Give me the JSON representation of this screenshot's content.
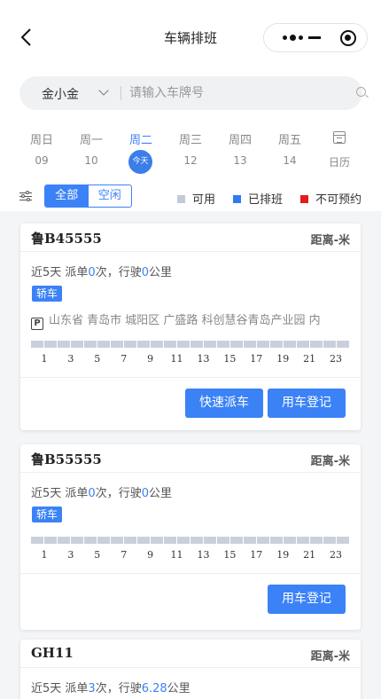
{
  "header": {
    "title": "车辆排班"
  },
  "search": {
    "owner": "金小金",
    "placeholder": "请输入车牌号"
  },
  "week": [
    {
      "weekday": "周日",
      "date": "09",
      "active": false
    },
    {
      "weekday": "周一",
      "date": "10",
      "active": false
    },
    {
      "weekday": "周二",
      "date": "今天",
      "active": true
    },
    {
      "weekday": "周三",
      "date": "12",
      "active": false
    },
    {
      "weekday": "周四",
      "date": "13",
      "active": false
    },
    {
      "weekday": "周五",
      "date": "14",
      "active": false
    }
  ],
  "calendar": {
    "label": "日历"
  },
  "filter": {
    "all": "全部",
    "idle": "空闲",
    "selected": "全部"
  },
  "legend": [
    {
      "label": "可用",
      "color": "#c2cad6"
    },
    {
      "label": "已排班",
      "color": "#2f7cf0"
    },
    {
      "label": "不可预约",
      "color": "#e11d1d"
    }
  ],
  "timeline_ticks": [
    "1",
    "3",
    "5",
    "7",
    "9",
    "11",
    "13",
    "15",
    "17",
    "19",
    "21",
    "23"
  ],
  "cards": [
    {
      "plate": "鲁B45555",
      "distance": "距离-米",
      "stats_prefix": "近5天 派单",
      "orders": "0",
      "stats_mid": "次，行驶",
      "mileage": "0",
      "stats_suffix": "公里",
      "type": "轿车",
      "location": "山东省 青岛市 城阳区 广盛路 科创慧谷青岛产业园 内",
      "dispatch_label": "快速派车",
      "register_label": "用车登记"
    },
    {
      "plate": "鲁B55555",
      "distance": "距离-米",
      "stats_prefix": "近5天 派单",
      "orders": "0",
      "stats_mid": "次，行驶",
      "mileage": "0",
      "stats_suffix": "公里",
      "type": "轿车",
      "register_label": "用车登记"
    },
    {
      "plate": "GH11",
      "distance": "距离-米",
      "stats_prefix": "近5天 派单",
      "orders": "3",
      "stats_mid": "次，行驶",
      "mileage": "6.28",
      "stats_suffix": "公里"
    }
  ]
}
